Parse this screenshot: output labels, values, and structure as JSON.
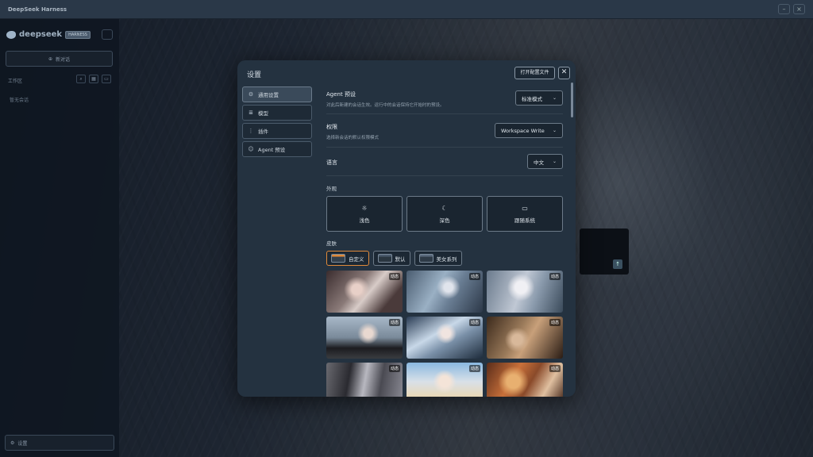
{
  "app": {
    "title": "DeepSeek Harness"
  },
  "sidebar": {
    "brand_name": "deepseek",
    "brand_version": "HARNESS",
    "new_chat_label": "新对话",
    "workspace_label": "工作区",
    "no_chats_label": "暂无会话",
    "settings_label": "设置"
  },
  "modal": {
    "title": "设置",
    "open_config_label": "打开配置文件",
    "close_label": "✕",
    "nav": [
      {
        "label": "通用设置",
        "icon": "gear-icon",
        "active": true
      },
      {
        "label": "模型",
        "icon": "database-icon",
        "active": false
      },
      {
        "label": "插件",
        "icon": "sliders-icon",
        "active": false
      },
      {
        "label": "Agent 预设",
        "icon": "robot-icon",
        "active": false
      }
    ],
    "agent_preset": {
      "title": "Agent 预设",
      "desc": "对此后新建的会话生效。运行中的会话保持它开始时的预设。",
      "value": "标准模式"
    },
    "permission": {
      "title": "权限",
      "desc": "选择新会话的默认权限模式",
      "value": "Workspace Write"
    },
    "language": {
      "title": "语言",
      "value": "中文"
    },
    "appearance": {
      "title": "外观",
      "options": [
        {
          "label": "浅色",
          "icon": "sun-icon"
        },
        {
          "label": "深色",
          "icon": "moon-icon"
        },
        {
          "label": "跟随系统",
          "icon": "monitor-icon"
        }
      ]
    },
    "skin": {
      "title": "皮肤",
      "tabs": [
        {
          "label": "自定义",
          "active": true
        },
        {
          "label": "默认",
          "active": false
        },
        {
          "label": "美女系列",
          "active": false
        }
      ],
      "thumbnails": [
        {
          "badge": "动态"
        },
        {
          "badge": "动态"
        },
        {
          "badge": "动态"
        },
        {
          "badge": "动态"
        },
        {
          "badge": "动态"
        },
        {
          "badge": "动态"
        },
        {
          "badge": "动态"
        },
        {
          "badge": "动态"
        },
        {
          "badge": "动态"
        }
      ]
    }
  }
}
